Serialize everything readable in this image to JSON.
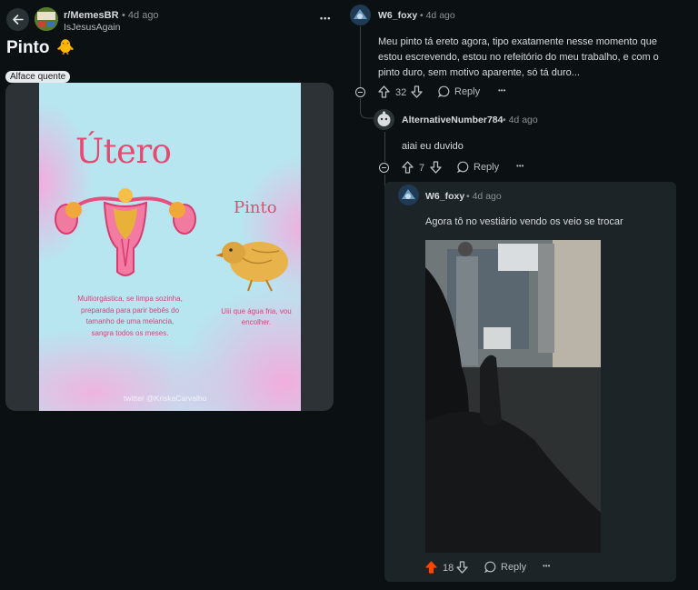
{
  "post": {
    "subreddit": "r/MemesBR",
    "age": "• 4d ago",
    "author": "IsJesusAgain",
    "title": "Pinto",
    "title_emoji": "🐥",
    "flair": "Alface quente",
    "more": "•••",
    "image_text": {
      "utero_title": "Útero",
      "pinto_title": "Pinto",
      "utero_desc": "Multiorgástica, se limpa sozinha, preparada para parir bebês do tamanho de uma melancia, sangra todos os meses.",
      "pinto_desc": "Uiii que água fria, vou encolher.",
      "credit": "twitter @KriskaCarvalho"
    }
  },
  "comments": [
    {
      "author": "W6_foxy",
      "age": "• 4d ago",
      "body": "Meu pinto tá ereto agora, tipo exatamente nesse momento que estou escrevendo, estou no refeitório do meu trabalho, e com o pinto duro, sem motivo aparente, só tá duro...",
      "votes": "32",
      "reply": "Reply",
      "more": "•••"
    },
    {
      "author": "AlternativeNumber784",
      "age": "• 4d ago",
      "body": "aiai eu duvido",
      "votes": "7",
      "reply": "Reply",
      "more": "•••"
    },
    {
      "author": "W6_foxy",
      "age": "• 4d ago",
      "body": "Agora tô no vestiário vendo os veio se trocar",
      "votes": "18",
      "reply": "Reply",
      "more": "•••"
    }
  ],
  "colors": {
    "background": "#0b1012",
    "upvote_active": "#ff4500",
    "meme_accent": "#e64a73"
  }
}
